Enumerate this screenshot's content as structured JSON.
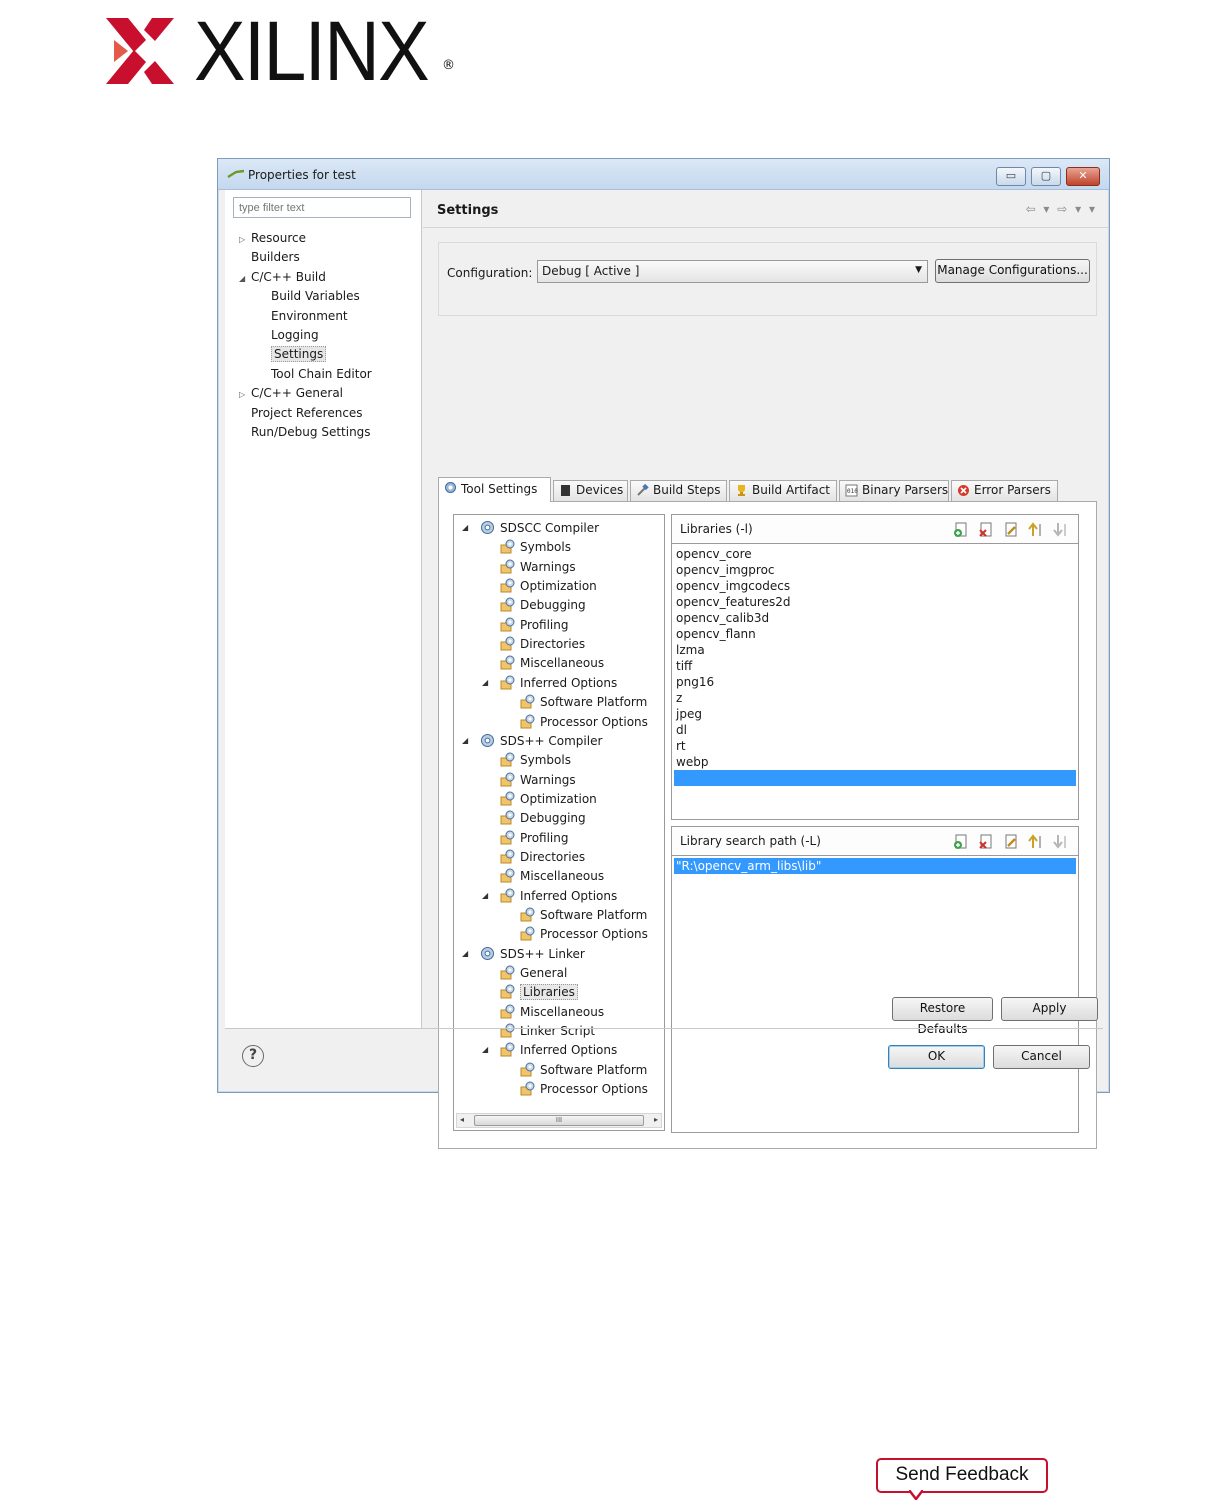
{
  "brand": {
    "wordmark": "XILINX",
    "registered": "®",
    "logo_color": "#c8102e"
  },
  "window": {
    "title": "Properties for test",
    "controls": {
      "minimize": "▭",
      "maximize": "▢",
      "close": "✕"
    }
  },
  "sidebar": {
    "filter_placeholder": "type filter text",
    "items": [
      {
        "label": "Resource",
        "twisty": "▷"
      },
      {
        "label": "Builders",
        "twisty": ""
      },
      {
        "label": "C/C++ Build",
        "twisty": "◢"
      },
      {
        "label": "Build Variables",
        "twisty": ""
      },
      {
        "label": "Environment",
        "twisty": ""
      },
      {
        "label": "Logging",
        "twisty": ""
      },
      {
        "label": "Settings",
        "twisty": "",
        "selected": true
      },
      {
        "label": "Tool Chain Editor",
        "twisty": ""
      },
      {
        "label": "C/C++ General",
        "twisty": "▷"
      },
      {
        "label": "Project References",
        "twisty": ""
      },
      {
        "label": "Run/Debug Settings",
        "twisty": ""
      }
    ]
  },
  "header": {
    "title": "Settings",
    "nav_arrows": "⇦ ▾ ⇨ ▾ ▾"
  },
  "configuration": {
    "label": "Configuration:",
    "value": "Debug  [ Active ]",
    "dropdown_arrow": "▼",
    "manage_button": "Manage Configurations..."
  },
  "tabs": [
    {
      "label": "Tool Settings",
      "icon": "gear-icon",
      "active": true
    },
    {
      "label": "Devices",
      "icon": "chip-icon"
    },
    {
      "label": "Build Steps",
      "icon": "hammer-icon"
    },
    {
      "label": "Build Artifact",
      "icon": "trophy-icon"
    },
    {
      "label": "Binary Parsers",
      "icon": "binary-icon"
    },
    {
      "label": "Error Parsers",
      "icon": "error-icon"
    }
  ],
  "tool_tree": [
    {
      "label": "SDSCC Compiler",
      "twisty": "◢",
      "type": "tool"
    },
    {
      "label": "Symbols",
      "type": "option"
    },
    {
      "label": "Warnings",
      "type": "option"
    },
    {
      "label": "Optimization",
      "type": "option"
    },
    {
      "label": "Debugging",
      "type": "option"
    },
    {
      "label": "Profiling",
      "type": "option"
    },
    {
      "label": "Directories",
      "type": "option"
    },
    {
      "label": "Miscellaneous",
      "type": "option"
    },
    {
      "label": "Inferred Options",
      "twisty": "◢",
      "type": "option"
    },
    {
      "label": "Software Platform",
      "type": "suboption"
    },
    {
      "label": "Processor Options",
      "type": "suboption"
    },
    {
      "label": "SDS++ Compiler",
      "twisty": "◢",
      "type": "tool"
    },
    {
      "label": "Symbols",
      "type": "option"
    },
    {
      "label": "Warnings",
      "type": "option"
    },
    {
      "label": "Optimization",
      "type": "option"
    },
    {
      "label": "Debugging",
      "type": "option"
    },
    {
      "label": "Profiling",
      "type": "option"
    },
    {
      "label": "Directories",
      "type": "option"
    },
    {
      "label": "Miscellaneous",
      "type": "option"
    },
    {
      "label": "Inferred Options",
      "twisty": "◢",
      "type": "option"
    },
    {
      "label": "Software Platform",
      "type": "suboption"
    },
    {
      "label": "Processor Options",
      "type": "suboption"
    },
    {
      "label": "SDS++ Linker",
      "twisty": "◢",
      "type": "tool"
    },
    {
      "label": "General",
      "type": "option"
    },
    {
      "label": "Libraries",
      "type": "option",
      "selected": true
    },
    {
      "label": "Miscellaneous",
      "type": "option"
    },
    {
      "label": "Linker Script",
      "type": "option"
    },
    {
      "label": "Inferred Options",
      "twisty": "◢",
      "type": "option"
    },
    {
      "label": "Software Platform",
      "type": "suboption"
    },
    {
      "label": "Processor Options",
      "type": "suboption"
    }
  ],
  "tree_scroll": {
    "left": "◂",
    "thumb": "III",
    "right": "▸"
  },
  "libraries": {
    "title": "Libraries (-l)",
    "items": [
      "opencv_core",
      "opencv_imgproc",
      "opencv_imgcodecs",
      "opencv_features2d",
      "opencv_calib3d",
      "opencv_flann",
      "lzma",
      "tiff",
      "png16",
      "z",
      "jpeg",
      "dl",
      "rt",
      "webp",
      ""
    ],
    "highlighted_index": 14
  },
  "library_paths": {
    "title": "Library search path (-L)",
    "items": [
      "\"R:\\opencv_arm_libs\\lib\""
    ],
    "highlighted_index": 0
  },
  "list_tools": [
    "add-icon",
    "delete-icon",
    "edit-icon",
    "move-up-icon",
    "move-down-icon"
  ],
  "buttons": {
    "restore": "Restore Defaults",
    "apply": "Apply",
    "ok": "OK",
    "cancel": "Cancel",
    "help": "?"
  },
  "feedback": {
    "label": "Send Feedback"
  },
  "colors": {
    "selection": "#3399ff",
    "window_border": "#7d9bbf",
    "feedback_border": "#c8102e"
  }
}
